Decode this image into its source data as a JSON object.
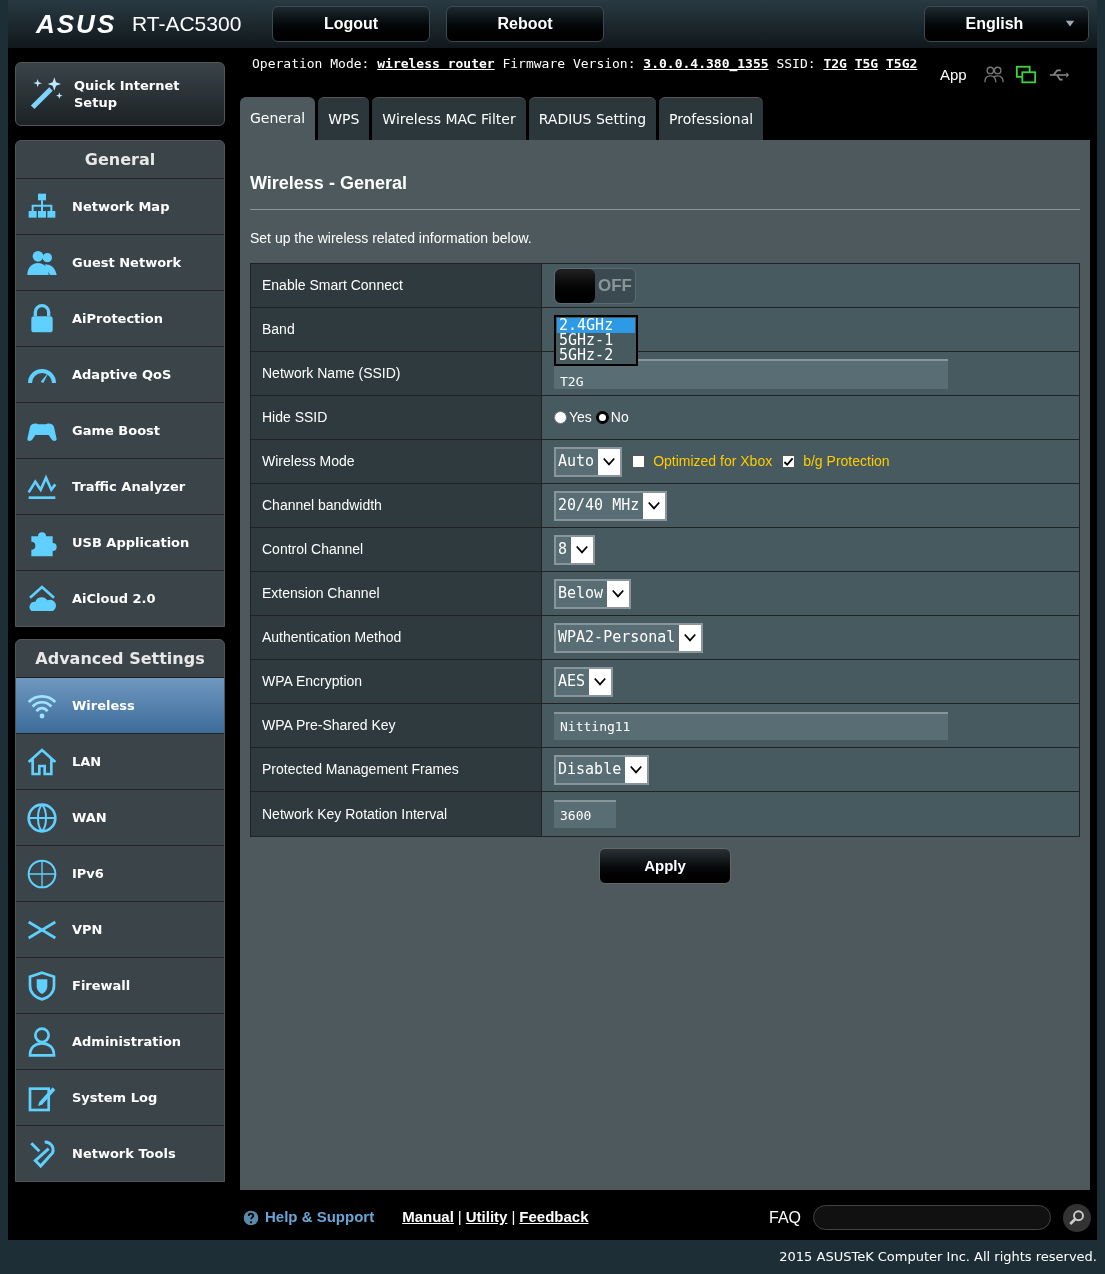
{
  "header": {
    "logo": "ASUS",
    "model": "RT-AC5300",
    "buttons": [
      "Logout",
      "Reboot"
    ],
    "language": "English"
  },
  "status": {
    "operation_mode_label": "Operation Mode:",
    "operation_mode": "wireless router",
    "firmware_label": "Firmware Version:",
    "firmware": "3.0.0.4.380_1355",
    "ssid_label": "SSID:",
    "ssids": [
      "T2G",
      "T5G",
      "T5G2"
    ],
    "app": "App"
  },
  "quick_setup": "Quick Internet Setup",
  "sidebar": {
    "general_title": "General",
    "general_items": [
      {
        "label": "Network Map",
        "selected": false
      },
      {
        "label": "Guest Network",
        "selected": false
      },
      {
        "label": "AiProtection",
        "selected": false
      },
      {
        "label": "Adaptive QoS",
        "selected": false
      },
      {
        "label": "Game Boost",
        "selected": false
      },
      {
        "label": "Traffic Analyzer",
        "selected": false
      },
      {
        "label": "USB Application",
        "selected": false
      },
      {
        "label": "AiCloud 2.0",
        "selected": false
      }
    ],
    "advanced_title": "Advanced Settings",
    "advanced_items": [
      {
        "label": "Wireless",
        "selected": true
      },
      {
        "label": "LAN",
        "selected": false
      },
      {
        "label": "WAN",
        "selected": false
      },
      {
        "label": "IPv6",
        "selected": false
      },
      {
        "label": "VPN",
        "selected": false
      },
      {
        "label": "Firewall",
        "selected": false
      },
      {
        "label": "Administration",
        "selected": false
      },
      {
        "label": "System Log",
        "selected": false
      },
      {
        "label": "Network Tools",
        "selected": false
      }
    ]
  },
  "tabs": [
    {
      "label": "General",
      "selected": true
    },
    {
      "label": "WPS",
      "selected": false
    },
    {
      "label": "Wireless MAC Filter",
      "selected": false
    },
    {
      "label": "RADIUS Setting",
      "selected": false
    },
    {
      "label": "Professional",
      "selected": false
    }
  ],
  "page": {
    "title": "Wireless - General",
    "description": "Set up the wireless related information below."
  },
  "form": [
    {
      "kind": "toggle",
      "label": "Enable Smart Connect",
      "on": false,
      "text": "OFF"
    },
    {
      "kind": "listbox",
      "label": "Band",
      "options": [
        {
          "label": "2.4GHz",
          "selected": true
        },
        {
          "label": "5GHz-1",
          "selected": false
        },
        {
          "label": "5GHz-2",
          "selected": false
        }
      ]
    },
    {
      "kind": "text",
      "label": "Network Name (SSID)",
      "value": "T2G"
    },
    {
      "kind": "radio",
      "label": "Hide SSID",
      "options": [
        {
          "label": "Yes",
          "selected": false
        },
        {
          "label": "No",
          "selected": true
        }
      ]
    },
    {
      "kind": "select",
      "label": "Wireless Mode",
      "value": "Auto",
      "checkboxes": [
        {
          "label": "Optimized for Xbox",
          "checked": false
        },
        {
          "label": "b/g Protection",
          "checked": true
        }
      ]
    },
    {
      "kind": "select",
      "label": "Channel bandwidth",
      "value": "20/40 MHz"
    },
    {
      "kind": "select",
      "label": "Control Channel",
      "value": "8"
    },
    {
      "kind": "select",
      "label": "Extension Channel",
      "value": "Below"
    },
    {
      "kind": "select",
      "label": "Authentication Method",
      "value": "WPA2-Personal"
    },
    {
      "kind": "select",
      "label": "WPA Encryption",
      "value": "AES"
    },
    {
      "kind": "text",
      "label": "WPA Pre-Shared Key",
      "value": "Nitting11"
    },
    {
      "kind": "select",
      "label": "Protected Management Frames",
      "value": "Disable"
    },
    {
      "kind": "number",
      "label": "Network Key Rotation Interval",
      "value": "3600"
    }
  ],
  "apply": "Apply",
  "footer": {
    "help": "Help & Support",
    "links": [
      "Manual",
      "Utility",
      "Feedback"
    ],
    "separators": [
      "|",
      "|"
    ],
    "faq": "FAQ",
    "copyright": "2015 ASUSTeK Computer Inc. All rights reserved."
  }
}
